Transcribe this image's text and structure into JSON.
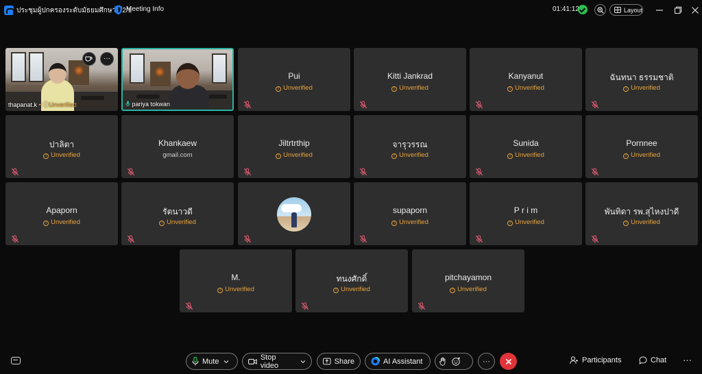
{
  "titlebar": {
    "meeting_title": "ประชุมผู้ปกครองระดับมัธยมศึกษาที่ 2/1",
    "meeting_info": "Meeting Info",
    "timer": "01:41:12",
    "layout": "Layout"
  },
  "video_tiles": [
    {
      "name": "thapanat.k",
      "status": "Unverified"
    },
    {
      "name": "pariya tokwan"
    }
  ],
  "tiles": [
    {
      "name": "Pui",
      "status": "Unverified",
      "verified": false
    },
    {
      "name": "Kitti Jankrad",
      "status": "Unverified",
      "verified": false
    },
    {
      "name": "Kanyanut",
      "status": "Unverified",
      "verified": false
    },
    {
      "name": "ฉันทนา  ธรรมชาติ",
      "status": "Unverified",
      "verified": false
    },
    {
      "name": "ปาลิตา",
      "status": "Unverified",
      "verified": false
    },
    {
      "name": "Khankaew",
      "status": "gmail.com",
      "verified": true
    },
    {
      "name": "Jiltrtrthip",
      "status": "Unverified",
      "verified": false
    },
    {
      "name": "จารุวรรณ",
      "status": "Unverified",
      "verified": false
    },
    {
      "name": "Sunida",
      "status": "Unverified",
      "verified": false
    },
    {
      "name": "Pornnee",
      "status": "Unverified",
      "verified": false
    },
    {
      "name": "Apaporn",
      "status": "Unverified",
      "verified": false
    },
    {
      "name": "รัตนาวดี",
      "status": "Unverified",
      "verified": false
    },
    {
      "name": "",
      "status": "",
      "verified": true,
      "avatar": true
    },
    {
      "name": "supaporn",
      "status": "Unverified",
      "verified": false
    },
    {
      "name": "P r i m",
      "status": "Unverified",
      "verified": false
    },
    {
      "name": "พันทิดา รพ.สุไหงปาดี",
      "status": "Unverified",
      "verified": false
    },
    {
      "name": "M.",
      "status": "Unverified",
      "verified": false
    },
    {
      "name": "ทนงศักดิ์",
      "status": "Unverified",
      "verified": false
    },
    {
      "name": "pitchayamon",
      "status": "Unverified",
      "verified": false
    }
  ],
  "controls": {
    "mute": "Mute",
    "stop_video": "Stop video",
    "share": "Share",
    "ai_assistant": "AI Assistant",
    "participants": "Participants",
    "chat": "Chat"
  },
  "colors": {
    "background": "#0b0b0b",
    "tile": "#2e2e2e",
    "unverified": "#e8a33d",
    "active_speaker": "#2bb3a3",
    "leave": "#e0343a",
    "muted_mic": "#e25b73"
  }
}
